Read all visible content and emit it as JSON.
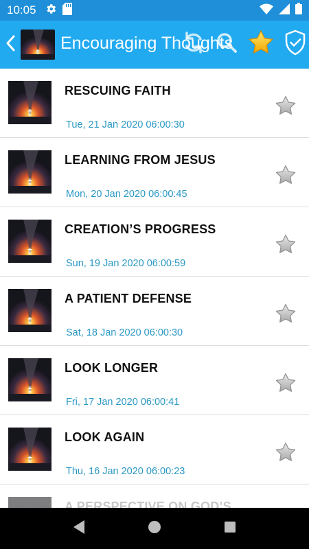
{
  "status_bar": {
    "time": "10:05",
    "icons_left": [
      "gear-icon",
      "sd-card-icon"
    ],
    "icons_right": [
      "wifi-icon",
      "signal-icon",
      "battery-icon"
    ]
  },
  "app_bar": {
    "title": "Encouraging Thoughts",
    "actions": [
      "refresh-icon",
      "search-icon",
      "star-icon",
      "shield-check-icon"
    ],
    "background": "#22aaf0"
  },
  "list": {
    "items": [
      {
        "title": "RESCUING FAITH",
        "date": "Tue, 21 Jan 2020 06:00:30",
        "favorite": false
      },
      {
        "title": "LEARNING FROM JESUS",
        "date": "Mon, 20 Jan 2020 06:00:45",
        "favorite": false
      },
      {
        "title": "CREATION’S PROGRESS",
        "date": "Sun, 19 Jan 2020 06:00:59",
        "favorite": false
      },
      {
        "title": "A PATIENT DEFENSE",
        "date": "Sat, 18 Jan 2020 06:00:30",
        "favorite": false
      },
      {
        "title": "LOOK LONGER",
        "date": "Fri, 17 Jan 2020 06:00:41",
        "favorite": false
      },
      {
        "title": "LOOK AGAIN",
        "date": "Thu, 16 Jan 2020 06:00:23",
        "favorite": false
      },
      {
        "title": "A PERSPECTIVE ON GOD’S",
        "date": "",
        "favorite": false
      }
    ]
  },
  "nav_bar": {
    "buttons": [
      "back-triangle-icon",
      "home-circle-icon",
      "recents-square-icon"
    ]
  },
  "colors": {
    "status_bar": "#1e8fd8",
    "app_bar": "#22aaf0",
    "date_text": "#2a98c4",
    "title_text": "#111111"
  }
}
